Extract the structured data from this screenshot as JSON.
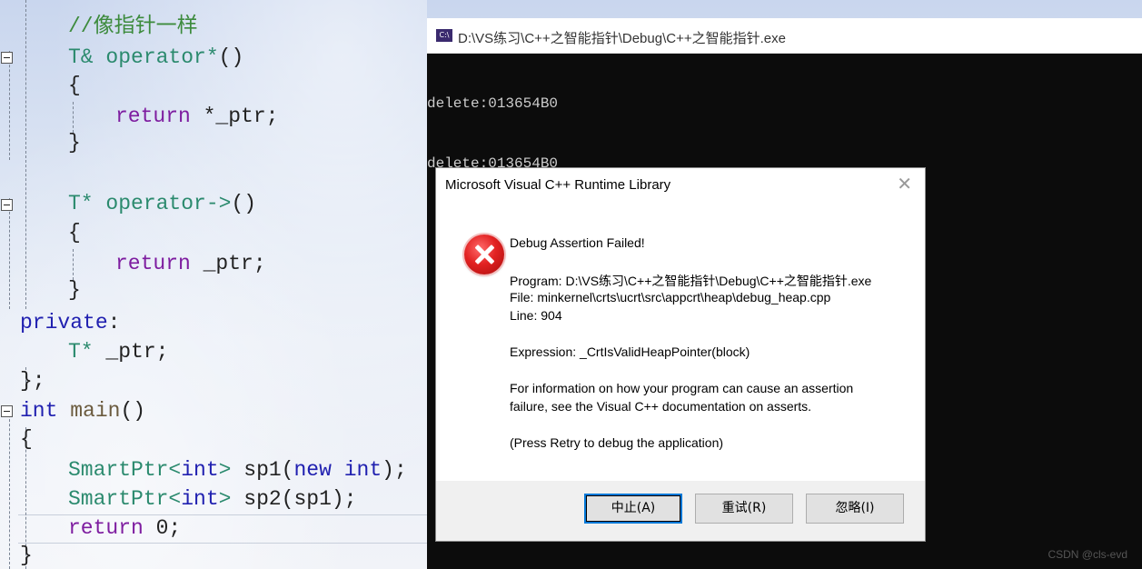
{
  "editor": {
    "lines": [
      {
        "segments": [
          {
            "t": "//像指针一样",
            "c": "cm"
          }
        ]
      },
      {
        "segments": [
          {
            "t": "T& ",
            "c": "tp"
          },
          {
            "t": "operator*",
            "c": "tp"
          },
          {
            "t": "()",
            "c": ""
          }
        ]
      },
      {
        "segments": [
          {
            "t": "{",
            "c": ""
          }
        ]
      },
      {
        "segments": [
          {
            "t": "return",
            "c": "kw"
          },
          {
            "t": " *_ptr;",
            "c": ""
          }
        ]
      },
      {
        "segments": [
          {
            "t": "}",
            "c": ""
          }
        ]
      },
      {
        "segments": [
          {
            "t": "T* ",
            "c": "tp"
          },
          {
            "t": "operator->",
            "c": "tp"
          },
          {
            "t": "()",
            "c": ""
          }
        ]
      },
      {
        "segments": [
          {
            "t": "{",
            "c": ""
          }
        ]
      },
      {
        "segments": [
          {
            "t": "return",
            "c": "kw"
          },
          {
            "t": " _ptr;",
            "c": ""
          }
        ]
      },
      {
        "segments": [
          {
            "t": "}",
            "c": ""
          }
        ]
      },
      {
        "segments": [
          {
            "t": "private",
            "c": "bl"
          },
          {
            "t": ":",
            "c": ""
          }
        ]
      },
      {
        "segments": [
          {
            "t": "T* ",
            "c": "tp"
          },
          {
            "t": "_ptr;",
            "c": ""
          }
        ]
      },
      {
        "segments": [
          {
            "t": "};",
            "c": ""
          }
        ]
      },
      {
        "segments": [
          {
            "t": "int",
            "c": "bl"
          },
          {
            "t": " ",
            "c": ""
          },
          {
            "t": "main",
            "c": "fn"
          },
          {
            "t": "()",
            "c": ""
          }
        ]
      },
      {
        "segments": [
          {
            "t": "{",
            "c": ""
          }
        ]
      },
      {
        "segments": [
          {
            "t": "SmartPtr<",
            "c": "tp"
          },
          {
            "t": "int",
            "c": "bl"
          },
          {
            "t": ">",
            "c": "tp"
          },
          {
            "t": " sp1(",
            "c": ""
          },
          {
            "t": "new",
            "c": "bl"
          },
          {
            "t": " ",
            "c": ""
          },
          {
            "t": "int",
            "c": "bl"
          },
          {
            "t": ");",
            "c": ""
          }
        ]
      },
      {
        "segments": [
          {
            "t": "SmartPtr<",
            "c": "tp"
          },
          {
            "t": "int",
            "c": "bl"
          },
          {
            "t": ">",
            "c": "tp"
          },
          {
            "t": " sp2(sp1);",
            "c": ""
          }
        ]
      },
      {
        "segments": [
          {
            "t": "return",
            "c": "kw"
          },
          {
            "t": " 0;",
            "c": ""
          }
        ]
      },
      {
        "segments": [
          {
            "t": "}",
            "c": ""
          }
        ]
      }
    ]
  },
  "console": {
    "title": "D:\\VS练习\\C++之智能指针\\Debug\\C++之智能指针.exe",
    "icon_label": "C:\\",
    "output": [
      "delete:013654B0",
      "delete:013654B0"
    ]
  },
  "dialog": {
    "title": "Microsoft Visual C++ Runtime Library",
    "close_glyph": "✕",
    "icon": "error-icon",
    "heading": "Debug Assertion Failed!",
    "program": "Program: D:\\VS练习\\C++之智能指针\\Debug\\C++之智能指针.exe",
    "file": "File: minkernel\\crts\\ucrt\\src\\appcrt\\heap\\debug_heap.cpp",
    "line": "Line: 904",
    "expression": "Expression: _CrtIsValidHeapPointer(block)",
    "info1": "For information on how your program can cause an assertion",
    "info2": "failure, see the Visual C++ documentation on asserts.",
    "hint": "(Press Retry to debug the application)",
    "buttons": {
      "abort": "中止(A)",
      "retry": "重试(R)",
      "ignore": "忽略(I)"
    }
  },
  "watermark": "CSDN @cls-evd",
  "colors": {
    "error_red": "#e22222",
    "console_bg": "#0c0c0c",
    "button_focus": "#0078d7"
  }
}
